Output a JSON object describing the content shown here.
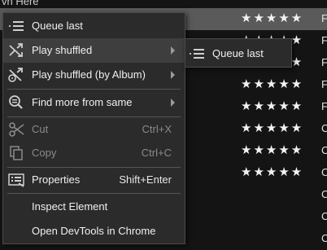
{
  "background": {
    "top_text": "vn Here",
    "rows": [
      {
        "stars": "★★★★★",
        "letter": "F",
        "selected": true
      },
      {
        "stars": "★★★★★",
        "letter": "F",
        "selected": false
      },
      {
        "stars": "★★★★★",
        "letter": "F",
        "selected": false
      },
      {
        "stars": "★★★★★",
        "letter": "F",
        "selected": false
      },
      {
        "stars": "★★★★★",
        "letter": "F",
        "selected": false
      },
      {
        "stars": "★★★★★",
        "letter": "C",
        "selected": false
      },
      {
        "stars": "★★★★★",
        "letter": "C",
        "selected": false
      },
      {
        "stars": "★★★★★",
        "letter": "C",
        "selected": false
      },
      {
        "stars": "",
        "letter": "C",
        "selected": false
      },
      {
        "stars": "",
        "letter": "C",
        "selected": false
      },
      {
        "stars": "",
        "letter": "C",
        "selected": false
      }
    ]
  },
  "menu": {
    "queue_last": "Queue last",
    "play_shuffled": "Play shuffled",
    "play_shuffled_album": "Play shuffled (by Album)",
    "find_more": "Find more from same",
    "cut": "Cut",
    "cut_shortcut": "Ctrl+X",
    "copy": "Copy",
    "copy_shortcut": "Ctrl+C",
    "properties": "Properties",
    "properties_shortcut": "Shift+Enter",
    "inspect": "Inspect Element",
    "devtools": "Open DevTools in Chrome"
  },
  "submenu": {
    "queue_last": "Queue last"
  },
  "icons": {
    "queue": "queue-list-icon",
    "shuffle": "shuffle-icon",
    "shuffle_album": "shuffle-album-icon",
    "find": "search-icon",
    "cut": "scissors-icon",
    "copy": "copy-icon",
    "properties": "properties-icon"
  },
  "colors": {
    "menu_bg": "#2b2b2b",
    "hover_bg": "#3e3e3e",
    "selected_row": "#5a5a5a",
    "disabled_text": "#8a8a8a"
  }
}
